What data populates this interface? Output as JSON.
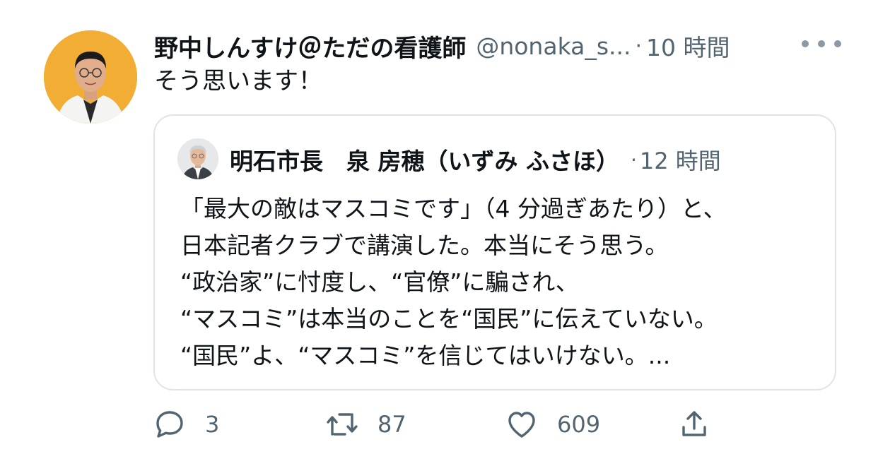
{
  "tweet": {
    "display_name": "野中しんすけ＠ただの看護師",
    "handle": "@nonaka_s...",
    "separator": "·",
    "time": "10 時間",
    "text": "そう思います！"
  },
  "quoted_tweet": {
    "display_name": "明石市長　泉 房穂（いずみ ふさほ）",
    "separator": "·",
    "time": "12 時間",
    "lines": [
      "「最大の敵はマスコミです」（4 分過ぎあたり）と、",
      "日本記者クラブで講演した。本当にそう思う。",
      "“政治家”に忖度し、“官僚”に騙され、",
      "“マスコミ”は本当のことを“国民”に伝えていない。",
      "“国民”よ、“マスコミ”を信じてはいけない。..."
    ]
  },
  "actions": {
    "reply_count": "3",
    "retweet_count": "87",
    "like_count": "609"
  },
  "icons": {
    "more": "more-horizontal-icon",
    "reply": "reply-icon",
    "retweet": "retweet-icon",
    "like": "heart-icon",
    "share": "share-icon"
  },
  "colors": {
    "text_primary": "#0f1419",
    "text_secondary": "#536471",
    "border": "#dfe4e8",
    "avatar_bg": "#f1a92c"
  }
}
